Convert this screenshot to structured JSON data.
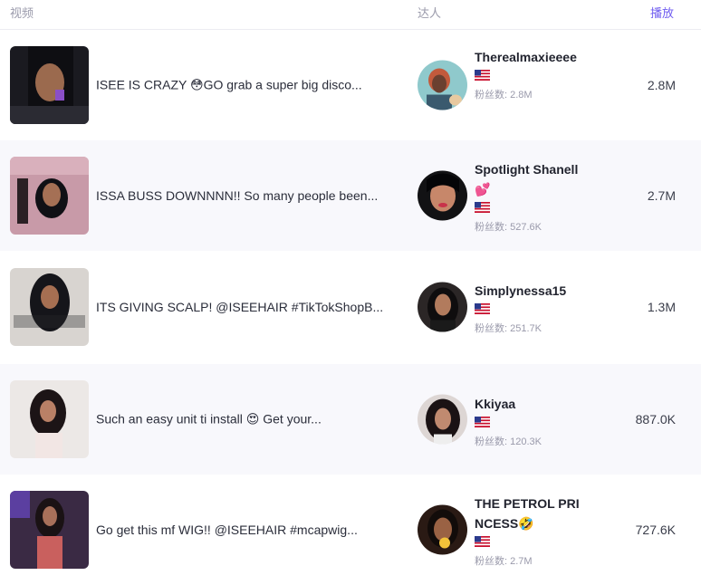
{
  "header": {
    "video": "视频",
    "creator": "达人",
    "plays": "播放"
  },
  "flag_icon": "us-flag-icon",
  "rows": [
    {
      "title": "ISEE IS CRAZY 😳GO grab a super big disco...",
      "name": "Therealmaxieeee",
      "fans": "粉丝数: 2.8M",
      "plays": "2.8M"
    },
    {
      "title": "ISSA BUSS DOWNNNN!! So many people been...",
      "name": "Spotlight Shanell 💕",
      "fans": "粉丝数: 527.6K",
      "plays": "2.7M"
    },
    {
      "title": "ITS GIVING SCALP! @ISEEHAIR #TikTokShopB...",
      "name": "Simplynessa15",
      "fans": "粉丝数: 251.7K",
      "plays": "1.3M"
    },
    {
      "title": "Such an easy unit ti install 😍 Get your...",
      "name": "Kkiyaa",
      "fans": "粉丝数: 120.3K",
      "plays": "887.0K"
    },
    {
      "title": "Go get this mf WIG!! @ISEEHAIR #mcapwig...",
      "name": "THE PETROL PRINCESS🤣",
      "fans": "粉丝数: 2.7M",
      "plays": "727.6K"
    }
  ]
}
